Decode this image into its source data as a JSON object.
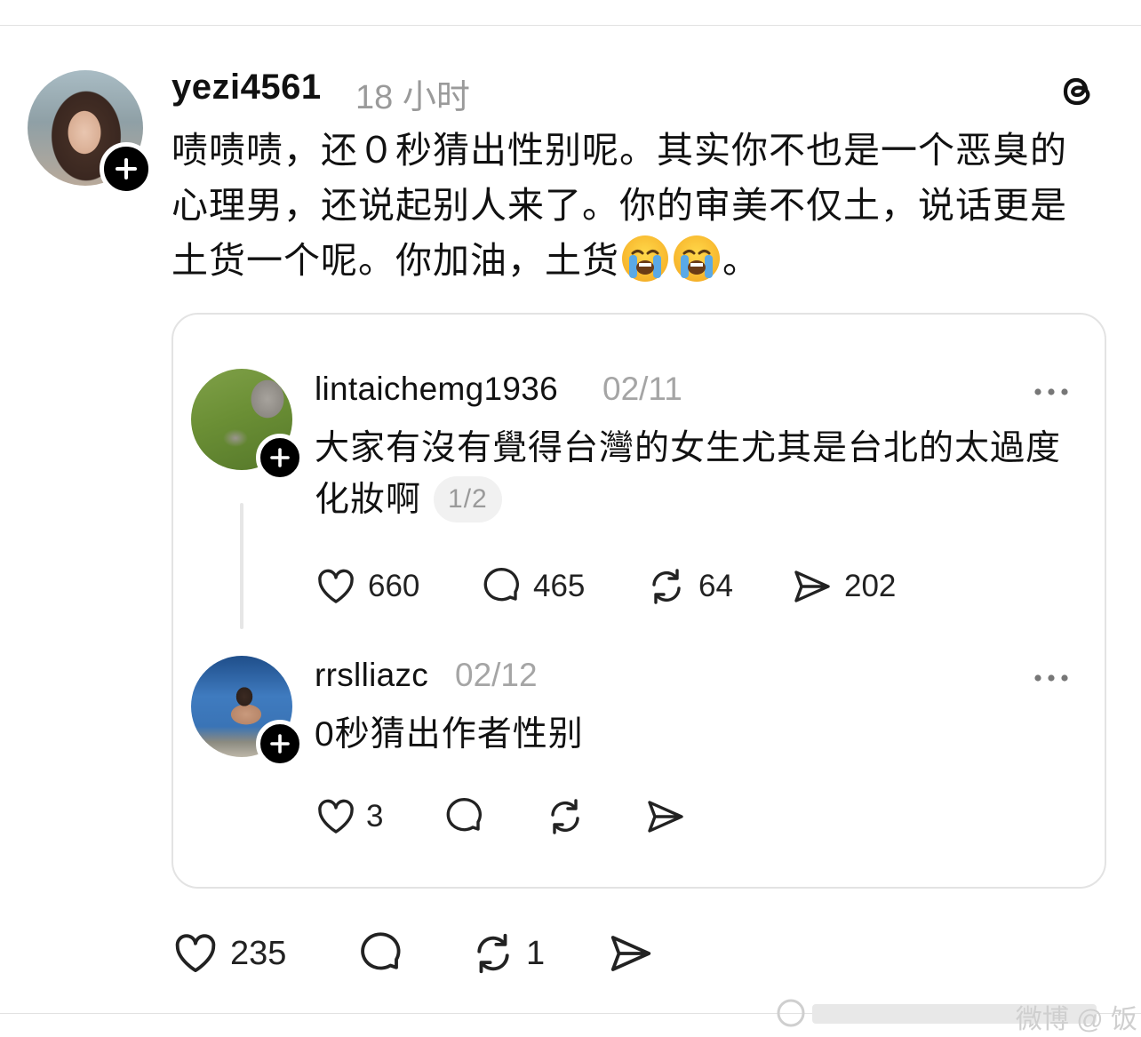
{
  "post": {
    "username": "yezi4561",
    "time": "18 小时",
    "text_before_emoji": "啧啧啧，还０秒猜出性别呢。其实你不也是一个恶臭的心理男，还说起别人来了。你的审美不仅土，说话更是土货一个呢。你加油，土货",
    "text_after_emoji": "。",
    "emojis": [
      "loudly-crying-face",
      "loudly-crying-face"
    ],
    "actions": {
      "likes": "235",
      "reposts": "1"
    }
  },
  "quote": {
    "post1": {
      "username": "lintaichemg1936",
      "date": "02/11",
      "text": "大家有沒有覺得台灣的女生尤其是台北的太過度化妝啊",
      "page_indicator": "1/2",
      "actions": {
        "likes": "660",
        "comments": "465",
        "reposts": "64",
        "shares": "202"
      }
    },
    "post2": {
      "username": "rrslliazc",
      "date": "02/12",
      "text": "0秒猜出作者性别",
      "actions": {
        "likes": "3"
      }
    }
  },
  "watermark": {
    "text": "微博 @ 饭"
  },
  "colors": {
    "text": "#111111",
    "muted": "#9a9a9a",
    "divider": "#e2e2e2",
    "badge": "#000000"
  }
}
